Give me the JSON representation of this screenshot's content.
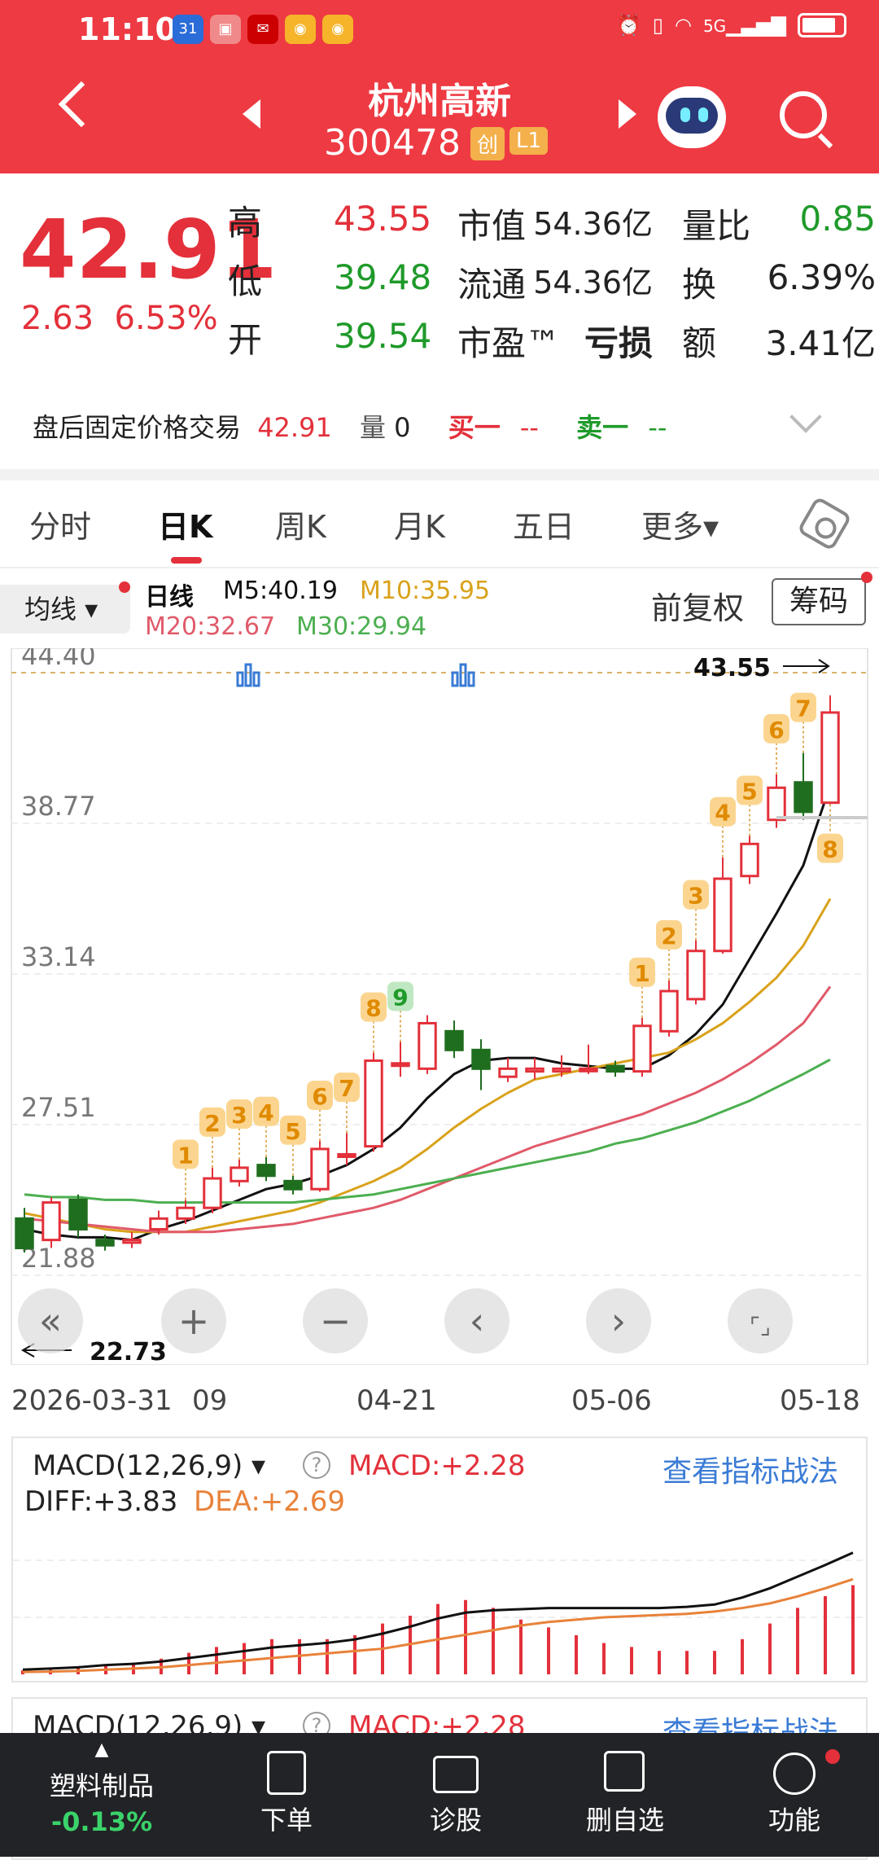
{
  "status": {
    "time": "11:10",
    "icons": [
      "calendar-icon",
      "huawei-icon",
      "mail-icon",
      "weibo-icon",
      "weibo-icon"
    ],
    "right_icons": [
      "alarm-icon",
      "vibrate-icon",
      "wifi-icon",
      "signal-5g-icon",
      "battery-icon"
    ],
    "signal_label": "5G"
  },
  "header": {
    "stock_name": "杭州高新",
    "stock_code": "300478",
    "badge1": "创",
    "badge2": "L1"
  },
  "quote": {
    "price": "42.91",
    "change": "2.63",
    "change_pct": "6.53%",
    "high_label": "高",
    "high": "43.55",
    "low_label": "低",
    "low": "39.48",
    "open_label": "开",
    "open": "39.54",
    "mktcap_label": "市值",
    "mktcap": "54.36亿",
    "float_label": "流通",
    "float": "54.36亿",
    "pe_label": "市盈™",
    "pe": "亏损",
    "volratio_label": "量比",
    "volratio": "0.85",
    "turnover_label": "换",
    "turnover": "6.39%",
    "amount_label": "额",
    "amount": "3.41亿"
  },
  "after_hours": {
    "label": "盘后固定价格交易",
    "price": "42.91",
    "vol_label": "量",
    "vol": "0",
    "buy_label": "买一",
    "buy": "--",
    "sell_label": "卖一",
    "sell": "--"
  },
  "tabs": [
    "分时",
    "日K",
    "周K",
    "月K",
    "五日",
    "更多▾"
  ],
  "legend": {
    "avg_btn": "均线 ▾",
    "daily": "日线",
    "m5": "M5:40.19",
    "m10": "M10:35.95",
    "m20": "M20:32.67",
    "m30": "M30:29.94",
    "fq": "前复权",
    "chip": "筹码"
  },
  "kline_labels": {
    "y_ticks": [
      "44.40",
      "38.77",
      "33.14",
      "27.51",
      "21.88"
    ],
    "high_mark": "43.55",
    "low_mark": "22.73",
    "x_ticks": [
      "2026-03-31",
      "09",
      "04-21",
      "05-06",
      "05-18"
    ]
  },
  "chart_data": {
    "type": "candlestick",
    "ylim": [
      21.88,
      44.4
    ],
    "y_ticks": [
      44.4,
      38.77,
      33.14,
      27.51,
      21.88
    ],
    "x_ticks": [
      "2026-03-31",
      "04-09",
      "04-21",
      "05-06",
      "05-18"
    ],
    "candles": [
      {
        "o": 24.0,
        "c": 22.9,
        "h": 24.4,
        "l": 22.73
      },
      {
        "o": 23.2,
        "c": 24.6,
        "h": 24.8,
        "l": 22.9
      },
      {
        "o": 24.7,
        "c": 23.6,
        "h": 24.9,
        "l": 23.3
      },
      {
        "o": 23.2,
        "c": 23.0,
        "h": 23.4,
        "l": 22.8
      },
      {
        "o": 23.1,
        "c": 23.2,
        "h": 23.5,
        "l": 22.9
      },
      {
        "o": 23.6,
        "c": 24.0,
        "h": 24.3,
        "l": 23.4
      },
      {
        "o": 24.0,
        "c": 24.4,
        "h": 24.7,
        "l": 23.8
      },
      {
        "o": 24.4,
        "c": 25.5,
        "h": 25.9,
        "l": 24.2
      },
      {
        "o": 25.4,
        "c": 25.9,
        "h": 26.2,
        "l": 25.2
      },
      {
        "o": 26.0,
        "c": 25.6,
        "h": 26.3,
        "l": 25.4
      },
      {
        "o": 25.4,
        "c": 25.1,
        "h": 25.6,
        "l": 24.9
      },
      {
        "o": 25.1,
        "c": 26.6,
        "h": 26.9,
        "l": 25.0
      },
      {
        "o": 26.4,
        "c": 26.4,
        "h": 27.2,
        "l": 26.0
      },
      {
        "o": 26.7,
        "c": 29.9,
        "h": 30.2,
        "l": 26.5
      },
      {
        "o": 29.8,
        "c": 29.8,
        "h": 30.6,
        "l": 29.3
      },
      {
        "o": 29.6,
        "c": 31.3,
        "h": 31.6,
        "l": 29.4
      },
      {
        "o": 31.0,
        "c": 30.3,
        "h": 31.4,
        "l": 30.0
      },
      {
        "o": 30.3,
        "c": 29.6,
        "h": 30.7,
        "l": 28.8
      },
      {
        "o": 29.3,
        "c": 29.6,
        "h": 30.0,
        "l": 29.1
      },
      {
        "o": 29.5,
        "c": 29.6,
        "h": 30.0,
        "l": 29.2
      },
      {
        "o": 29.5,
        "c": 29.6,
        "h": 30.1,
        "l": 29.3
      },
      {
        "o": 29.6,
        "c": 29.6,
        "h": 30.5,
        "l": 29.4
      },
      {
        "o": 29.7,
        "c": 29.5,
        "h": 29.9,
        "l": 29.3
      },
      {
        "o": 29.5,
        "c": 31.2,
        "h": 31.5,
        "l": 29.3
      },
      {
        "o": 31.0,
        "c": 32.5,
        "h": 32.9,
        "l": 30.8
      },
      {
        "o": 32.2,
        "c": 34.0,
        "h": 34.4,
        "l": 32.0
      },
      {
        "o": 34.0,
        "c": 36.7,
        "h": 37.5,
        "l": 33.9
      },
      {
        "o": 36.8,
        "c": 38.0,
        "h": 38.3,
        "l": 36.5
      },
      {
        "o": 38.9,
        "c": 40.1,
        "h": 40.6,
        "l": 38.6
      },
      {
        "o": 40.3,
        "c": 39.2,
        "h": 41.4,
        "l": 38.9
      },
      {
        "o": 39.54,
        "c": 42.91,
        "h": 43.55,
        "l": 39.48
      }
    ],
    "ma": {
      "M5": [
        23.6,
        23.4,
        23.3,
        23.3,
        23.2,
        23.6,
        23.9,
        24.3,
        24.7,
        25.1,
        25.3,
        25.6,
        26.0,
        26.6,
        27.4,
        28.5,
        29.4,
        29.9,
        30.0,
        30.0,
        29.8,
        29.7,
        29.6,
        29.6,
        30.1,
        30.9,
        32.0,
        33.7,
        35.4,
        37.2,
        40.19
      ],
      "M10": [
        24.2,
        24.0,
        23.8,
        23.6,
        23.5,
        23.5,
        23.5,
        23.7,
        23.9,
        24.1,
        24.3,
        24.6,
        25.0,
        25.4,
        25.9,
        26.6,
        27.4,
        28.1,
        28.7,
        29.2,
        29.4,
        29.6,
        29.8,
        30.0,
        30.2,
        30.7,
        31.3,
        32.1,
        33.0,
        34.2,
        35.95
      ],
      "M20": [
        24.0,
        23.9,
        23.8,
        23.7,
        23.6,
        23.5,
        23.5,
        23.5,
        23.6,
        23.7,
        23.8,
        24.0,
        24.2,
        24.4,
        24.7,
        25.1,
        25.5,
        25.9,
        26.3,
        26.7,
        27.0,
        27.3,
        27.6,
        27.9,
        28.3,
        28.7,
        29.2,
        29.8,
        30.5,
        31.3,
        32.67
      ],
      "M30": [
        24.9,
        24.8,
        24.8,
        24.7,
        24.7,
        24.6,
        24.6,
        24.6,
        24.6,
        24.6,
        24.6,
        24.7,
        24.8,
        24.9,
        25.1,
        25.3,
        25.5,
        25.7,
        25.9,
        26.1,
        26.3,
        26.5,
        26.8,
        27.0,
        27.3,
        27.6,
        28.0,
        28.4,
        28.9,
        29.4,
        29.94
      ]
    },
    "markers": [
      {
        "i": 6,
        "label": "1"
      },
      {
        "i": 7,
        "label": "2"
      },
      {
        "i": 8,
        "label": "3"
      },
      {
        "i": 9,
        "label": "4"
      },
      {
        "i": 10,
        "label": "5"
      },
      {
        "i": 11,
        "label": "6"
      },
      {
        "i": 12,
        "label": "7"
      },
      {
        "i": 13,
        "label": "8"
      },
      {
        "i": 14,
        "label": "9",
        "green": true
      },
      {
        "i": 23,
        "label": "1"
      },
      {
        "i": 24,
        "label": "2"
      },
      {
        "i": 25,
        "label": "3"
      },
      {
        "i": 26,
        "label": "4"
      },
      {
        "i": 27,
        "label": "5"
      },
      {
        "i": 28,
        "label": "6"
      },
      {
        "i": 29,
        "label": "7"
      },
      {
        "i": 30,
        "label": "8",
        "below": true
      }
    ],
    "macd": {
      "dif": [
        -1.2,
        -1.15,
        -1.1,
        -1.0,
        -0.95,
        -0.85,
        -0.7,
        -0.55,
        -0.4,
        -0.25,
        -0.15,
        -0.05,
        0.1,
        0.35,
        0.65,
        1.0,
        1.25,
        1.35,
        1.4,
        1.45,
        1.45,
        1.45,
        1.45,
        1.45,
        1.5,
        1.6,
        1.9,
        2.3,
        2.8,
        3.3,
        3.83
      ],
      "dea": [
        -1.3,
        -1.28,
        -1.25,
        -1.2,
        -1.15,
        -1.1,
        -1.0,
        -0.9,
        -0.8,
        -0.7,
        -0.6,
        -0.5,
        -0.4,
        -0.3,
        -0.1,
        0.1,
        0.3,
        0.5,
        0.7,
        0.85,
        0.95,
        1.05,
        1.1,
        1.15,
        1.2,
        1.3,
        1.45,
        1.65,
        1.95,
        2.3,
        2.69
      ],
      "hist": [
        0.1,
        0.15,
        0.2,
        0.25,
        0.3,
        0.4,
        0.55,
        0.7,
        0.8,
        0.9,
        0.9,
        0.9,
        1.0,
        1.3,
        1.5,
        1.8,
        1.9,
        1.7,
        1.4,
        1.2,
        1.0,
        0.8,
        0.7,
        0.6,
        0.6,
        0.6,
        0.9,
        1.3,
        1.7,
        2.0,
        2.28
      ]
    }
  },
  "macd": {
    "title": "MACD(12,26,9)",
    "macd_label": "MACD:+2.28",
    "dif_label": "DIFF:+3.83",
    "dea_label": "DEA:+2.69",
    "link": "查看指标战法"
  },
  "bottom": {
    "sector_name": "塑料制品",
    "sector_change": "-0.13%",
    "items": [
      "下单",
      "诊股",
      "删自选",
      "功能"
    ]
  },
  "colors": {
    "brand_red": "#ee3a43",
    "up": "#e3303a",
    "down": "#1f6e1f",
    "m5": "#111111",
    "m10": "#d9a21b",
    "m20": "#e05a6a",
    "m30": "#4caf50",
    "link": "#3a7bd5"
  }
}
